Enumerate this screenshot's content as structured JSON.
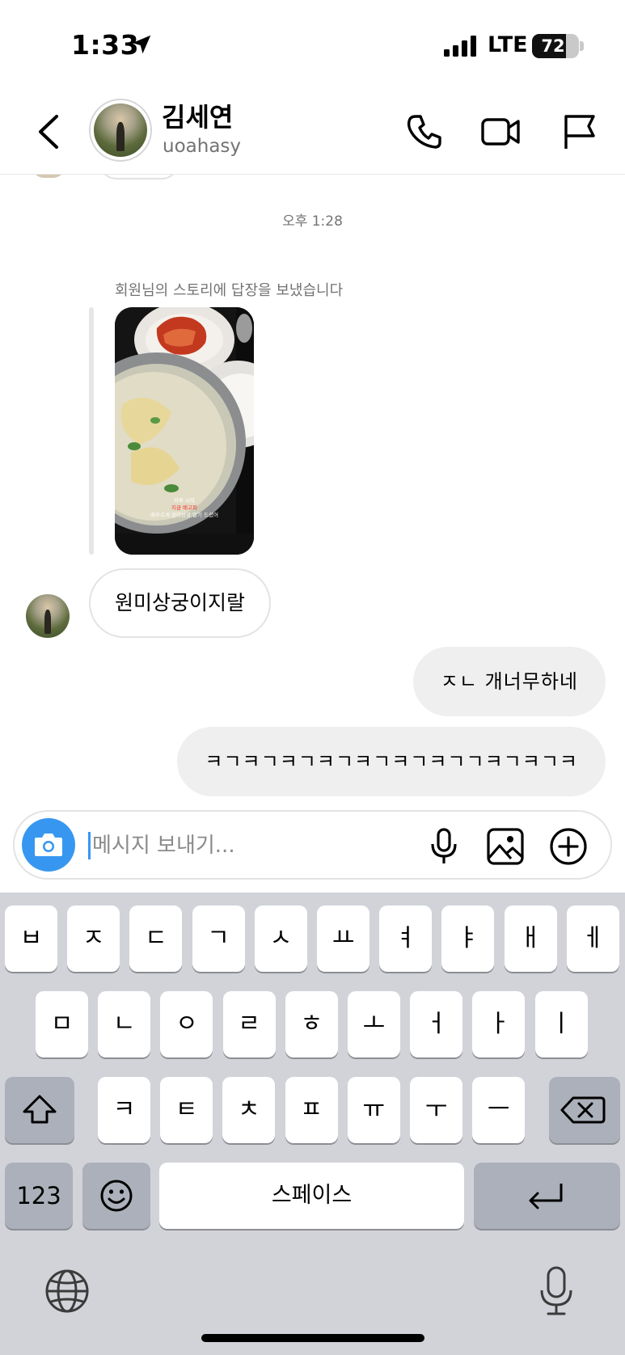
{
  "status_bar": {
    "time": "1:33",
    "network": "LTE",
    "battery": "72",
    "battery_level": 0.72
  },
  "header": {
    "name": "김세연",
    "username": "uoahasy"
  },
  "chat": {
    "timestamp": "오후 1:28",
    "story_reply_label": "회원님의 스토리에 답장을 보냈습니다",
    "story_caption_line1": "하루 시작",
    "story_caption_line2": "지금 배고파",
    "story_caption_line3": "배부르게 원미상궁 알기 드셨어",
    "incoming_message": "원미상궁이지랄",
    "outgoing_messages": [
      "ㅈㄴ 개너무하네",
      "ㅋㄱㅋㄱㅋㄱㅋㄱㅋㄱㅋㄱㅋㄱㄱㅋㄱㅋㄱㅋ"
    ]
  },
  "composer": {
    "placeholder": "메시지 보내기..."
  },
  "keyboard": {
    "row1": [
      "ㅂ",
      "ㅈ",
      "ㄷ",
      "ㄱ",
      "ㅅ",
      "ㅛ",
      "ㅕ",
      "ㅑ",
      "ㅐ",
      "ㅔ"
    ],
    "row2": [
      "ㅁ",
      "ㄴ",
      "ㅇ",
      "ㄹ",
      "ㅎ",
      "ㅗ",
      "ㅓ",
      "ㅏ",
      "ㅣ"
    ],
    "row3": [
      "ㅋ",
      "ㅌ",
      "ㅊ",
      "ㅍ",
      "ㅠ",
      "ㅜ",
      "ㅡ"
    ],
    "numbers_key": "123",
    "space_key": "스페이스"
  },
  "colors": {
    "accent": "#3797f0",
    "outgoing_bubble": "#efefef",
    "keyboard_bg": "#d1d3d9"
  },
  "icons": [
    "location-arrow-icon",
    "signal-icon",
    "back-chevron-icon",
    "phone-icon",
    "video-icon",
    "flag-icon",
    "camera-icon",
    "microphone-icon",
    "image-icon",
    "plus-circle-icon",
    "shift-icon",
    "backspace-icon",
    "emoji-icon",
    "return-icon",
    "globe-icon",
    "dictation-mic-icon"
  ]
}
